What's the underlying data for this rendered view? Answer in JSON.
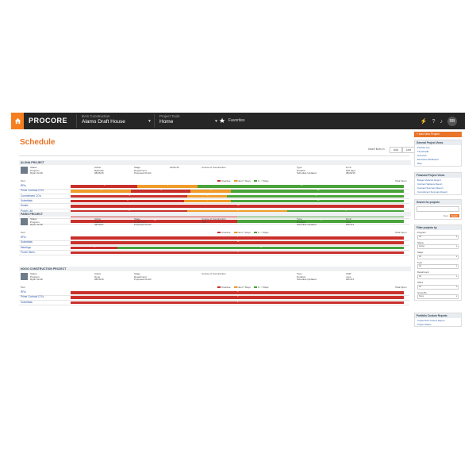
{
  "nav": {
    "company_small": "BAS Construction",
    "company": "Alamo Draft House",
    "tools_small": "Project Tools",
    "tools": "Home",
    "favorites": "Favorites",
    "logo": "PROCORE",
    "avatar": "RB"
  },
  "page": {
    "title": "Schedule",
    "toggle_label": "Insert lines in",
    "toggle_a": "Add",
    "toggle_b": "Line",
    "legend": {
      "red": "Overdue",
      "orange": "Next 7 Days",
      "green": "0 - 7 Days"
    },
    "tool_header": "Tool",
    "total_header": "Total Open"
  },
  "colors": {
    "red": "#c9302c",
    "orange": "#ef9c2a",
    "green": "#4aa33b"
  },
  "sections": [
    {
      "title": "ALOHA PROJECT",
      "info": [
        [
          "Status",
          "Program",
          "Rylan Smith"
        ],
        [
          "Active",
          "Belleville",
          "08/26/16"
        ],
        [
          "Stage",
          "Department",
          "Proposed Finish"
        ],
        [
          "",
          "",
          "01/01/16"
        ],
        [
          "Course of Construction",
          "",
          ""
        ],
        [
          "Type",
          "Duration",
          "Schedule Updated"
        ],
        [
          "R-10",
          "185 days",
          "08/26/16"
        ]
      ],
      "rows": [
        {
          "label": "RFIs",
          "segments": [
            {
              "c": "red",
              "p": 20,
              "n": "6"
            },
            {
              "c": "orange",
              "p": 18,
              "n": "7"
            },
            {
              "c": "green",
              "p": 62,
              "n": "14"
            }
          ]
        },
        {
          "label": "Prime Contract CO's",
          "segments": [
            {
              "c": "orange",
              "p": 18,
              "n": "3"
            },
            {
              "c": "red",
              "p": 18,
              "n": "3"
            },
            {
              "c": "orange",
              "p": 12,
              "n": "6"
            },
            {
              "c": "green",
              "p": 52,
              "n": "12"
            }
          ]
        },
        {
          "label": "Commitment CO's",
          "segments": [
            {
              "c": "red",
              "p": 35,
              "n": "4"
            },
            {
              "c": "orange",
              "p": 12,
              "n": "2"
            },
            {
              "c": "green",
              "p": 53,
              "n": "9"
            }
          ]
        },
        {
          "label": "Submittals",
          "segments": [
            {
              "c": "red",
              "p": 34,
              "n": "8"
            },
            {
              "c": "orange",
              "p": 14,
              "n": "7"
            },
            {
              "c": "green",
              "p": 52,
              "n": "10"
            }
          ]
        },
        {
          "label": "Emails",
          "segments": [
            {
              "c": "red",
              "p": 100,
              "n": "25"
            }
          ]
        },
        {
          "label": "Punch List",
          "segments": [
            {
              "c": "red",
              "p": 35,
              "n": "8"
            },
            {
              "c": "orange",
              "p": 30,
              "n": "6"
            },
            {
              "c": "green",
              "p": 35,
              "n": "5"
            }
          ]
        },
        {
          "label": "Meetings",
          "segments": [
            {
              "c": "red",
              "p": 50,
              "n": "11"
            },
            {
              "c": "green",
              "p": 50,
              "n": "8"
            }
          ]
        },
        {
          "label": "ASI",
          "segments": [
            {
              "c": "red",
              "p": 50,
              "n": "14"
            },
            {
              "c": "green",
              "p": 50,
              "n": "8"
            }
          ]
        }
      ]
    },
    {
      "title": "PARIS PROJECT",
      "info": [
        [
          "Status",
          "Program",
          "Rylan Smith"
        ],
        [
          "Active",
          "Oakland",
          "08/26/97"
        ],
        [
          "Stage",
          "Department",
          "Proposed Finish"
        ],
        [
          "",
          "",
          ""
        ],
        [
          "Course of Construction",
          "PWC",
          ""
        ],
        [
          "Type",
          "Duration",
          "Schedule Updated"
        ],
        [
          "R-10",
          "none",
          "9/01/13"
        ]
      ],
      "rows": [
        {
          "label": "RFIs",
          "segments": [
            {
              "c": "red",
              "p": 100,
              "n": "7"
            }
          ]
        },
        {
          "label": "Submittals",
          "segments": [
            {
              "c": "red",
              "p": 100,
              "n": "11"
            }
          ]
        },
        {
          "label": "Meetings",
          "segments": [
            {
              "c": "red",
              "p": 14,
              "n": "3"
            },
            {
              "c": "green",
              "p": 86,
              "n": "9"
            }
          ]
        },
        {
          "label": "Punch Items",
          "segments": [
            {
              "c": "red",
              "p": 100,
              "n": "5"
            }
          ]
        }
      ]
    },
    {
      "title": "NOGO CONSTRUCTION PROJECT",
      "info": [
        [
          "Status",
          "Program",
          "Rylan Smith"
        ],
        [
          "Active",
          "None",
          "08/26/16"
        ],
        [
          "Stage",
          "Department",
          "Proposed Finish"
        ],
        [
          "",
          "",
          ""
        ],
        [
          "Course of Construction",
          "",
          ""
        ],
        [
          "Type",
          "Duration",
          "Schedule Updated"
        ],
        [
          "CMP",
          "none",
          "9/01/13"
        ]
      ],
      "rows": [
        {
          "label": "RFIs",
          "segments": [
            {
              "c": "red",
              "p": 100,
              "n": "4"
            }
          ]
        },
        {
          "label": "Prime Contract CO's",
          "segments": [
            {
              "c": "red",
              "p": 100,
              "n": "3"
            }
          ]
        },
        {
          "label": "Submittals",
          "segments": [
            {
              "c": "red",
              "p": 100,
              "n": "2"
            }
          ]
        }
      ]
    }
  ],
  "sidebar": {
    "new_project": "Add New Project",
    "general_views_title": "General Project Views",
    "general_views": [
      "Portfolio List",
      "Thumbnails",
      "Overview",
      "Executive Dashboard",
      "Map"
    ],
    "financial_views_title": "Financial Project Views",
    "financial_views": [
      "Budget Variance Report",
      "Contract Variance Report",
      "Contract Summary Report",
      "Commitment Summary Report"
    ],
    "search_title": "Search for projects",
    "search_clear": "Clear",
    "search_button": "Search",
    "filter_title": "Filter projects by",
    "filters": [
      {
        "label": "Program",
        "value": "All"
      },
      {
        "label": "Status",
        "value": "Active"
      },
      {
        "label": "Stage",
        "value": "All"
      },
      {
        "label": "Type",
        "value": "All"
      },
      {
        "label": "Department",
        "value": "All"
      },
      {
        "label": "Office",
        "value": "All"
      },
      {
        "label": "Group By",
        "value": "None"
      }
    ],
    "custom_title": "Portfolio Custom Reports",
    "custom_items": [
      "Create New Custom Report",
      "Project Status"
    ]
  }
}
